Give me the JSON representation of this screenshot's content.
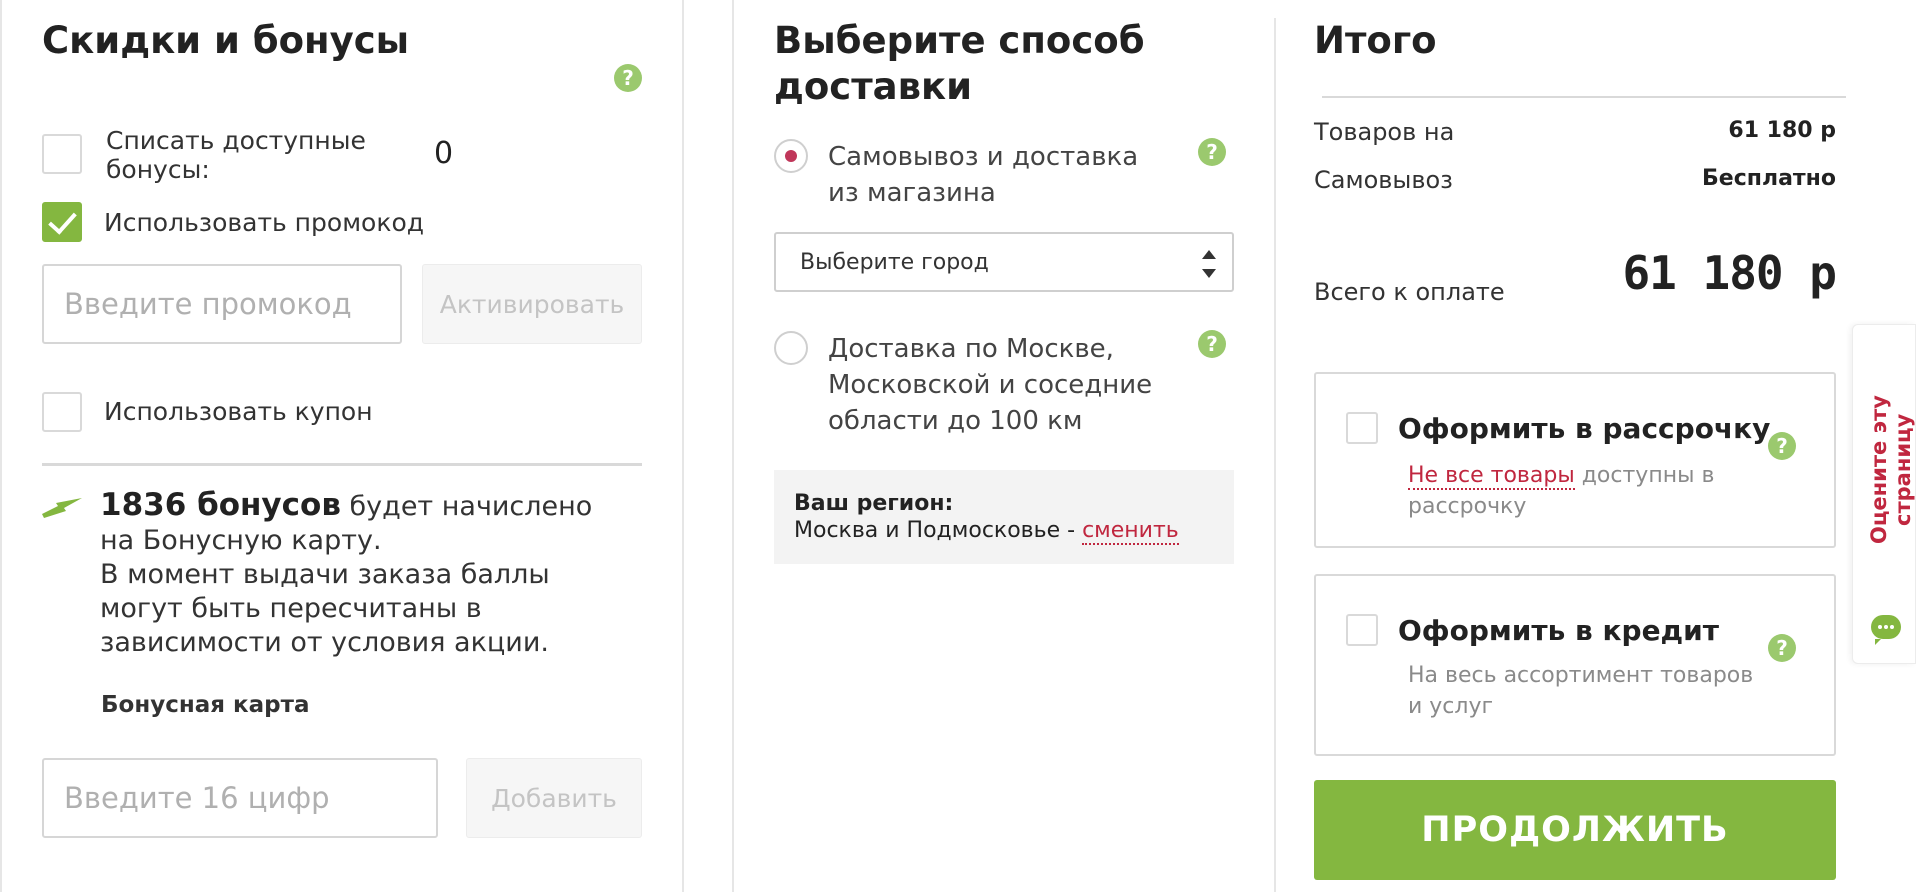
{
  "discounts": {
    "title": "Скидки и бонусы",
    "help_icon": "?",
    "use_bonuses_label": "Списать доступные бонусы:",
    "bonuses_available": "0",
    "use_promo_label": "Использовать промокод",
    "promo_placeholder": "Введите промокод",
    "activate_label": "Активировать",
    "use_coupon_label": "Использовать купон",
    "bonus_amount": "1836 бонусов",
    "bonus_text1": " будет начислено на Бонусную карту.",
    "bonus_text2": "В момент выдачи заказа баллы могут быть пересчитаны в зависимости от условия акции.",
    "bonus_card_label": "Бонусная карта",
    "card_placeholder": "Введите 16 цифр",
    "add_label": "Добавить"
  },
  "delivery": {
    "title": "Выберите способ доставки",
    "option1": "Самовывоз и доставка из магазина",
    "city_select": "Выберите город",
    "option2": "Доставка по Москве, Московской и соседние области до 100 км",
    "region_label": "Ваш регион:",
    "region_value": "Москва и Подмосковье - ",
    "change_link": "сменить"
  },
  "summary": {
    "title": "Итого",
    "goods_label": "Товаров на",
    "goods_value": "61 180 р",
    "pickup_label": "Самовывоз",
    "pickup_value": "Бесплатно",
    "total_label": "Всего к оплате",
    "total_value": "61 180 р",
    "installment_title": "Оформить в рассрочку",
    "installment_link": "Не все товары",
    "installment_rest": " доступны в рассрочку",
    "credit_title": "Оформить в кредит",
    "credit_desc": "На весь ассортимент товаров и услуг",
    "continue_label": "ПРОДОЛЖИТЬ"
  },
  "feedback": {
    "label": "Оцените эту страницу"
  },
  "colors": {
    "accent_green": "#84b740",
    "help_green": "#9bc96e",
    "link_red": "#c0273f"
  }
}
